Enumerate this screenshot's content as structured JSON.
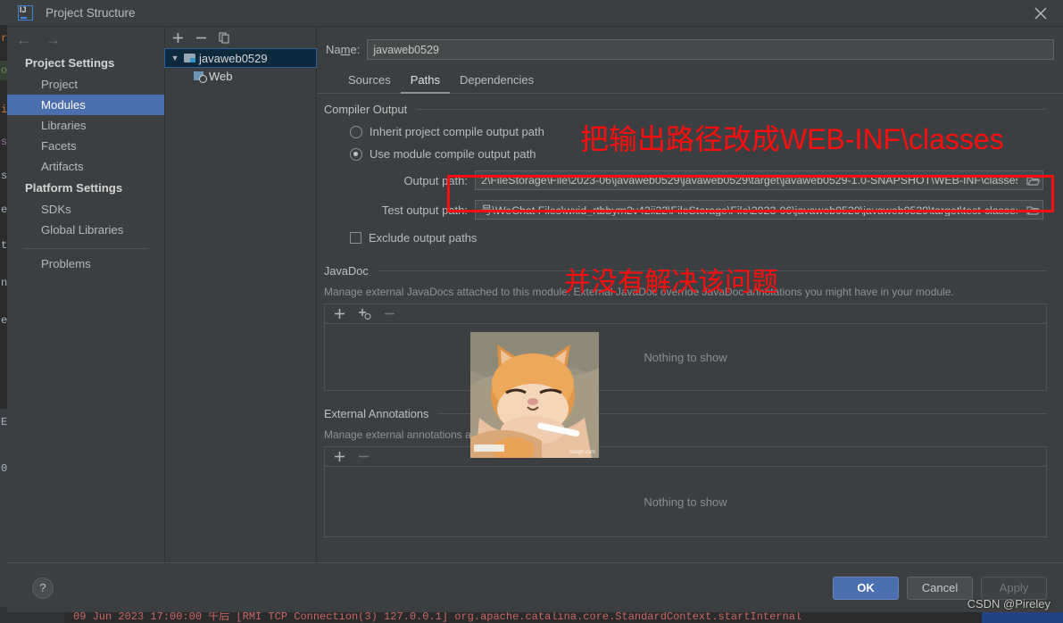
{
  "window": {
    "title": "Project Structure",
    "app_icon": "intellij-idea-logo",
    "close_icon": "close-icon"
  },
  "nav": {
    "back_icon": "arrow-left-icon",
    "forward_icon": "arrow-right-icon",
    "groups": [
      {
        "title": "Project Settings",
        "items": [
          {
            "label": "Project",
            "selected": false
          },
          {
            "label": "Modules",
            "selected": true
          },
          {
            "label": "Libraries",
            "selected": false
          },
          {
            "label": "Facets",
            "selected": false
          },
          {
            "label": "Artifacts",
            "selected": false
          }
        ]
      },
      {
        "title": "Platform Settings",
        "items": [
          {
            "label": "SDKs",
            "selected": false
          },
          {
            "label": "Global Libraries",
            "selected": false
          }
        ]
      }
    ],
    "extra": [
      {
        "label": "Problems"
      }
    ]
  },
  "tree": {
    "toolbar": {
      "add_icon": "plus-icon",
      "remove_icon": "minus-icon",
      "copy_icon": "copy-icon"
    },
    "nodes": [
      {
        "label": "javaweb0529",
        "icon": "module-icon",
        "selected": true,
        "expanded": true
      },
      {
        "label": "Web",
        "icon": "web-facet-icon",
        "selected": false
      }
    ]
  },
  "main": {
    "name_label": "Name:",
    "name_value": "javaweb0529",
    "tabs": [
      {
        "label": "Sources",
        "active": false
      },
      {
        "label": "Paths",
        "active": true
      },
      {
        "label": "Dependencies",
        "active": false
      }
    ],
    "compiler_output": {
      "section_title": "Compiler Output",
      "radio_inherit": "Inherit project compile output path",
      "radio_module": "Use module compile output path",
      "radio_selected": "module",
      "output_path_label": "Output path:",
      "output_path_value": "2\\FileStorage\\File\\2023-06\\javaweb0529\\javaweb0529\\target\\javaweb0529-1.0-SNAPSHOT\\WEB-INF\\classes",
      "test_output_path_label": "Test output path:",
      "test_output_path_value": "号\\WeChat Files\\wxid_rtbbym2v42ii22\\FileStorage\\File\\2023-06\\javaweb0529\\javaweb0529\\target\\test-classes",
      "browse_icon": "folder-browse-icon",
      "exclude_label": "Exclude output paths",
      "exclude_checked": false
    },
    "javadoc": {
      "section_title": "JavaDoc",
      "description": "Manage external JavaDocs attached to this module. External JavaDoc override JavaDoc annotations you might have in your module.",
      "toolbar": {
        "add_icon": "plus-icon",
        "add_url_icon": "plus-globe-icon",
        "remove_icon": "minus-icon"
      },
      "empty_text": "Nothing to show"
    },
    "external_annotations": {
      "section_title": "External Annotations",
      "description": "Manage external annotations attached to this module.",
      "toolbar": {
        "add_icon": "plus-icon",
        "remove_icon": "minus-icon"
      },
      "empty_text": "Nothing to show"
    }
  },
  "annotations": {
    "note_top": "把输出路径改成WEB-INF\\classes",
    "note_bottom": "并没有解决该问题",
    "highlight_color": "#ff0d0d"
  },
  "overlay_image": {
    "name": "cat-meme-image",
    "watermark": "soogif.com"
  },
  "footer": {
    "help_icon": "question-mark-icon",
    "ok_label": "OK",
    "cancel_label": "Cancel",
    "apply_label": "Apply",
    "apply_enabled": false,
    "watermark": "CSDN @Pireley"
  },
  "background": {
    "gutter_letters": [
      "r",
      "o",
      "i",
      "s",
      "s",
      "e",
      "t",
      "n",
      "e",
      "E",
      "0"
    ],
    "console_line": "09 Jun 2023 17:00:00 午后 [RMI TCP Connection(3) 127.0.0.1] org.apache.catalina.core.StandardContext.startInternal",
    "accent": "#4b6eaf"
  }
}
